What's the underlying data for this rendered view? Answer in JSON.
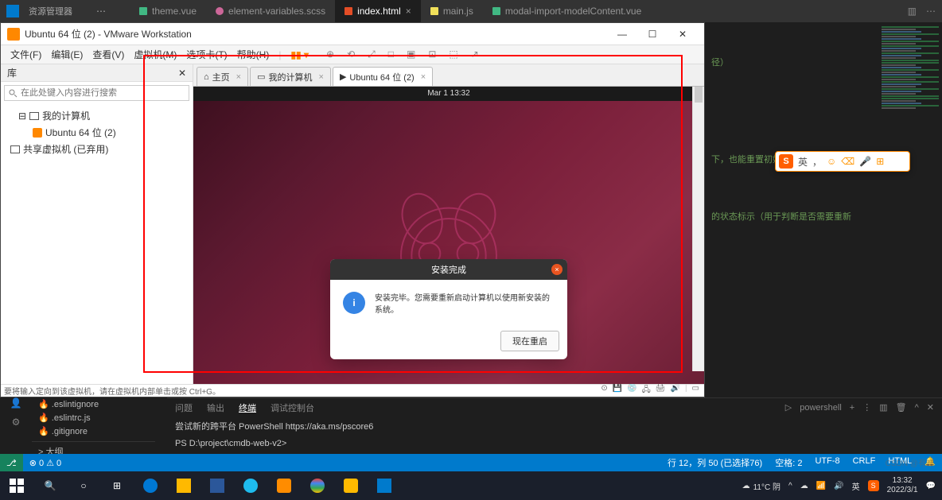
{
  "vscode": {
    "explorer_label": "资源管理器",
    "tabs": [
      {
        "icon": "vue",
        "label": "theme.vue",
        "active": false
      },
      {
        "icon": "scss",
        "label": "element-variables.scss",
        "active": false
      },
      {
        "icon": "html",
        "label": "index.html",
        "active": true,
        "close": "×"
      },
      {
        "icon": "js",
        "label": "main.js",
        "active": false
      },
      {
        "icon": "vue",
        "label": "modal-import-modelContent.vue",
        "active": false
      }
    ],
    "left_files": [
      ".eslintignore",
      ".eslintrc.js",
      ".gitignore"
    ],
    "outline": "> 大纲",
    "terminal_tabs": {
      "problems": "问题",
      "output": "输出",
      "terminal": "终端",
      "debug": "调试控制台"
    },
    "terminal_shell": "powershell",
    "terminal_lines": [
      "尝试新的跨平台 PowerShell https://aka.ms/pscore6",
      "PS D:\\project\\cmdb-web-v2>"
    ],
    "code_hint1": "径）",
    "code_hint2": "下，也能重置初始化项目中所有状态）",
    "code_hint3": "的状态标示（用于判断是否需要重新",
    "status": {
      "remote": "⎇",
      "errors": "⊗ 0 ⚠ 0",
      "cursor": "行 12，列 50 (已选择76)",
      "spaces": "空格: 2",
      "encoding": "UTF-8",
      "eol": "CRLF",
      "lang": "HTML",
      "bell": "🔔"
    }
  },
  "vmware": {
    "title": "Ubuntu 64 位 (2) - VMware Workstation",
    "menu": [
      "文件(F)",
      "编辑(E)",
      "查看(V)",
      "虚拟机(M)",
      "选项卡(T)",
      "帮助(H)"
    ],
    "sidebar_title": "库",
    "search_placeholder": "在此处键入内容进行搜索",
    "tree": {
      "mypc": "我的计算机",
      "vm": "Ubuntu 64 位 (2)",
      "shared": "共享虚拟机 (已弃用)"
    },
    "vmtabs": {
      "home": "主页",
      "mypc": "我的计算机",
      "ubuntu": "Ubuntu 64 位 (2)"
    },
    "ubuntu_time": "Mar 1  13:32",
    "dialog": {
      "title": "安装完成",
      "message": "安装完毕。您需要重新启动计算机以使用新安装的系统。",
      "button": "现在重启"
    },
    "statusbar": "要将输入定向到该虚拟机，请在虚拟机内部单击或按 Ctrl+G。"
  },
  "ime": {
    "lang": "英",
    "comma": "，"
  },
  "taskbar": {
    "weather": "11°C 阴",
    "time": "13:32",
    "date": "2022/3/1"
  },
  "watermark": "CSDN @有蝉"
}
